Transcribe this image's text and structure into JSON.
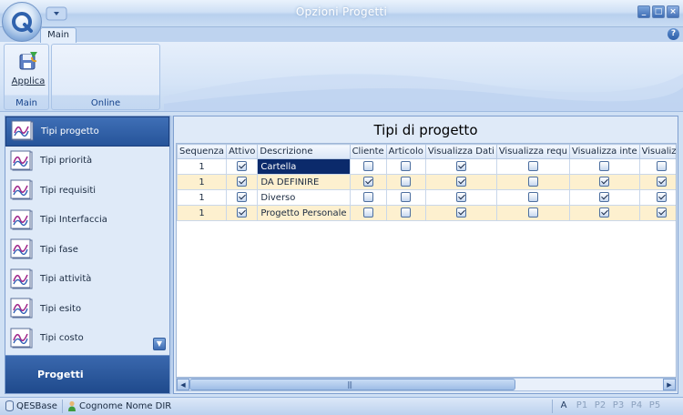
{
  "window": {
    "title": "Opzioni Progetti"
  },
  "ribbon": {
    "tabs": [
      {
        "label": "Main"
      }
    ],
    "groups": [
      {
        "label": "Main",
        "buttons": [
          {
            "label": "Applica",
            "icon": "apply-save-icon"
          }
        ]
      },
      {
        "label": "Online",
        "buttons": []
      }
    ],
    "help_glyph": "?"
  },
  "nav": {
    "items": [
      {
        "label": "Tipi progetto",
        "selected": true
      },
      {
        "label": "Tipi priorità"
      },
      {
        "label": "Tipi requisiti"
      },
      {
        "label": "Tipi Interfaccia"
      },
      {
        "label": "Tipi fase"
      },
      {
        "label": "Tipi attività"
      },
      {
        "label": "Tipi esito"
      },
      {
        "label": "Tipi costo"
      }
    ],
    "footer": "Progetti"
  },
  "grid": {
    "title": "Tipi di progetto",
    "columns": [
      "Sequenza",
      "Attivo",
      "Descrizione",
      "Cliente",
      "Articolo",
      "Visualizza Dati",
      "Visualizza requ",
      "Visualizza inte",
      "Visualizz"
    ],
    "rows": [
      {
        "sequenza": "1",
        "attivo": true,
        "descrizione": "Cartella",
        "cliente": false,
        "articolo": false,
        "vis_dati": true,
        "vis_req": false,
        "vis_int": false,
        "vis_x": false
      },
      {
        "sequenza": "1",
        "attivo": true,
        "descrizione": "DA DEFINIRE",
        "cliente": true,
        "articolo": false,
        "vis_dati": true,
        "vis_req": false,
        "vis_int": true,
        "vis_x": true
      },
      {
        "sequenza": "1",
        "attivo": true,
        "descrizione": "Diverso",
        "cliente": false,
        "articolo": false,
        "vis_dati": true,
        "vis_req": false,
        "vis_int": true,
        "vis_x": true
      },
      {
        "sequenza": "1",
        "attivo": true,
        "descrizione": "Progetto Personale",
        "cliente": false,
        "articolo": false,
        "vis_dati": true,
        "vis_req": false,
        "vis_int": true,
        "vis_x": true
      }
    ]
  },
  "statusbar": {
    "database": "QESBase",
    "user": "Cognome Nome DIR",
    "indicators": [
      "A",
      "P1",
      "P2",
      "P3",
      "P4",
      "P5"
    ]
  },
  "colors": {
    "selection": "#0b2a6b",
    "accent": "#26549a",
    "row_alt": "#fdf0cf"
  }
}
